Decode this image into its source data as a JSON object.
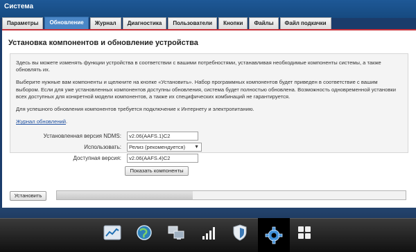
{
  "window": {
    "title": "Система"
  },
  "tabs": [
    {
      "label": "Параметры"
    },
    {
      "label": "Обновление",
      "active": true
    },
    {
      "label": "Журнал"
    },
    {
      "label": "Диагностика"
    },
    {
      "label": "Пользователи"
    },
    {
      "label": "Кнопки"
    },
    {
      "label": "Файлы"
    },
    {
      "label": "Файл подкачки"
    }
  ],
  "main": {
    "title": "Установка компонентов и обновление устройства",
    "info": {
      "p1": "Здесь вы можете изменять функции устройства в соответствии с вашими потребностями, устанавливая необходимые компоненты системы, а также обновлять их.",
      "p2": "Выберите нужные вам компоненты и щелкните на кнопке «Установить». Набор программных компонентов будет приведен в соответствие с вашим выбором. Если для уже установленных компонентов доступны обновления, система будет полностью обновлена. Возможность одновременной установки всех доступных для конкретной модели компонентов, а также их специфических комбинаций не гарантируется.",
      "p3": "Для успешного обновления компонентов требуется подключение к Интернету и электропитанию.",
      "link": "Журнал обновлений",
      "link_suffix": "."
    },
    "form": {
      "installed_label": "Установленная версия NDMS:",
      "installed_value": "v2.06(AAFS.1)C2",
      "use_label": "Использовать:",
      "use_value": "Релиз (рекомендуется)",
      "available_label": "Доступная версия:",
      "available_value": "v2.06(AAFS.4)C2",
      "show_components_button": "Показать компоненты"
    },
    "install_button": "Установить",
    "progress": 0.39
  },
  "dock": {
    "items": [
      {
        "icon": "chart-icon"
      },
      {
        "icon": "globe-icon"
      },
      {
        "icon": "network-icon"
      },
      {
        "icon": "signal-icon"
      },
      {
        "icon": "shield-icon"
      },
      {
        "icon": "gear-icon",
        "active": true
      },
      {
        "icon": "apps-grid-icon"
      }
    ]
  }
}
